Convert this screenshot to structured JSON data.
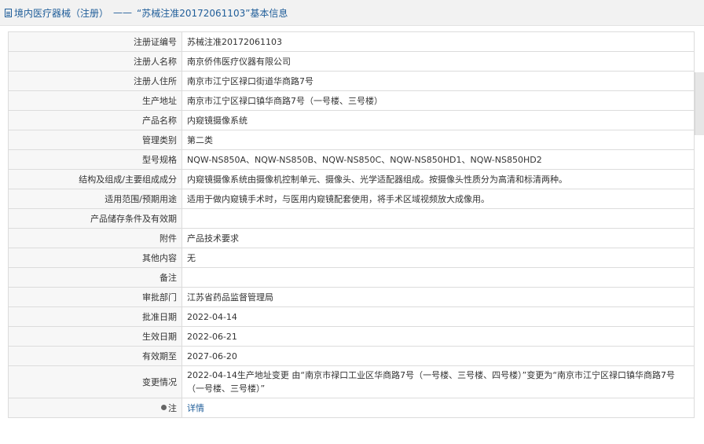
{
  "header": {
    "title_part1": "境内医疗器械（注册）",
    "separator": "——",
    "title_part2": "“苏械注准20172061103”基本信息"
  },
  "rows": [
    {
      "label": "注册证编号",
      "value": "苏械注准20172061103"
    },
    {
      "label": "注册人名称",
      "value": "南京侨伟医疗仪器有限公司"
    },
    {
      "label": "注册人住所",
      "value": "南京市江宁区禄口街道华商路7号"
    },
    {
      "label": "生产地址",
      "value": "南京市江宁区禄口镇华商路7号（一号楼、三号楼）"
    },
    {
      "label": "产品名称",
      "value": "内窥镜摄像系统"
    },
    {
      "label": "管理类别",
      "value": "第二类"
    },
    {
      "label": "型号规格",
      "value": "NQW-NS850A、NQW-NS850B、NQW-NS850C、NQW-NS850HD1、NQW-NS850HD2"
    },
    {
      "label": "结构及组成/主要组成成分",
      "value": "内窥镜摄像系统由摄像机控制单元、摄像头、光学适配器组成。按摄像头性质分为高清和标清两种。"
    },
    {
      "label": "适用范围/预期用途",
      "value": "适用于做内窥镜手术时，与医用内窥镜配套使用，将手术区域视频放大成像用。"
    },
    {
      "label": "产品储存条件及有效期",
      "value": ""
    },
    {
      "label": "附件",
      "value": "产品技术要求"
    },
    {
      "label": "其他内容",
      "value": "无"
    },
    {
      "label": "备注",
      "value": ""
    },
    {
      "label": "审批部门",
      "value": "江苏省药品监督管理局"
    },
    {
      "label": "批准日期",
      "value": "2022-04-14"
    },
    {
      "label": "生效日期",
      "value": "2022-06-21"
    },
    {
      "label": "有效期至",
      "value": "2027-06-20"
    },
    {
      "label": "变更情况",
      "value": "2022-04-14生产地址变更 由“南京市禄口工业区华商路7号（一号楼、三号楼、四号楼）”变更为“南京市江宁区禄口镇华商路7号（一号楼、三号楼）”"
    }
  ],
  "note_row": {
    "label": "注",
    "link_text": "详情"
  },
  "colors": {
    "header_text": "#1f5d99",
    "link": "#1f5d99",
    "label_bg": "#f7f7f7",
    "border": "#dcdcdc"
  },
  "icons": {
    "header": "document-icon",
    "note": "pin-icon"
  }
}
